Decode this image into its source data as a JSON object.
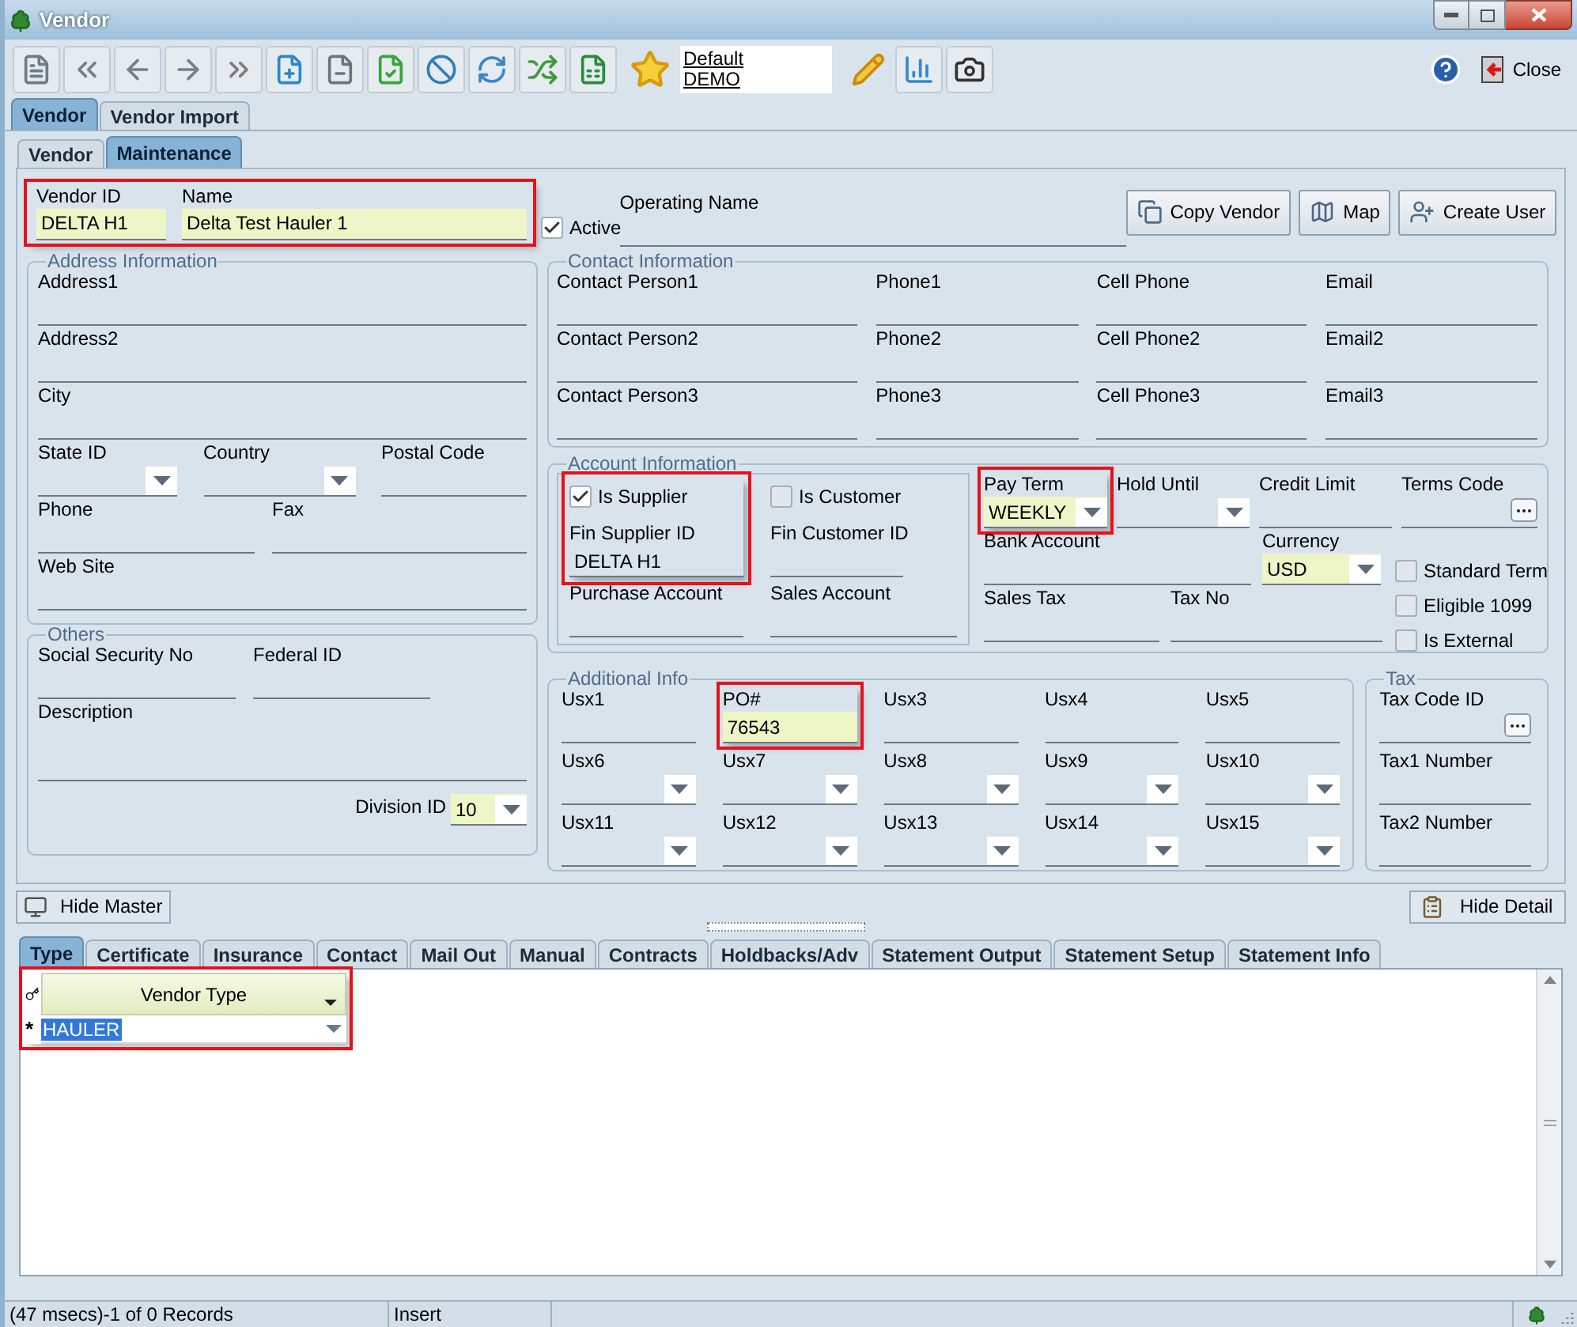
{
  "window": {
    "title": "Vendor"
  },
  "toolbar": {
    "profile_links": [
      "Default",
      "DEMO"
    ],
    "close_label": "Close"
  },
  "main_tabs": [
    {
      "label": "Vendor",
      "selected": true
    },
    {
      "label": "Vendor Import",
      "selected": false
    }
  ],
  "sub_tabs": [
    {
      "label": "Vendor",
      "selected": false
    },
    {
      "label": "Maintenance",
      "selected": true
    }
  ],
  "header": {
    "id_group": {
      "highlighted": true,
      "fields": [
        {
          "label": "Vendor ID",
          "value": "DELTA H1",
          "kind": "required-text"
        },
        {
          "label": "Name",
          "value": "Delta Test Hauler 1",
          "kind": "required-text"
        }
      ]
    },
    "active": {
      "label": "Active",
      "checked": true
    },
    "operating_name": {
      "label": "Operating Name",
      "kind": "text"
    },
    "buttons": [
      "Copy Vendor",
      "Map",
      "Create User"
    ]
  },
  "address_information": {
    "title": "Address Information",
    "rows": [
      [
        {
          "label": "Address1",
          "kind": "text"
        }
      ],
      [
        {
          "label": "Address2",
          "kind": "text"
        }
      ],
      [
        {
          "label": "City",
          "kind": "text"
        }
      ],
      [
        {
          "label": "State ID",
          "kind": "dropdown"
        },
        {
          "label": "Country",
          "kind": "dropdown"
        },
        {
          "label": "Postal Code",
          "kind": "text"
        }
      ],
      [
        {
          "label": "Phone",
          "kind": "text"
        },
        {
          "label": "Fax",
          "kind": "text"
        }
      ],
      [
        {
          "label": "Web Site",
          "kind": "text"
        }
      ]
    ]
  },
  "others": {
    "title": "Others",
    "rows": [
      [
        {
          "label": "Social Security No",
          "kind": "text"
        },
        {
          "label": "Federal ID",
          "kind": "text"
        }
      ],
      [
        {
          "label": "Description",
          "kind": "text"
        }
      ]
    ],
    "division": {
      "label": "Division ID",
      "value": "10",
      "kind": "required-dropdown"
    }
  },
  "contact_information": {
    "title": "Contact Information",
    "rows": [
      [
        {
          "label": "Contact Person1",
          "kind": "text"
        },
        {
          "label": "Phone1",
          "kind": "text"
        },
        {
          "label": "Cell Phone",
          "kind": "text"
        },
        {
          "label": "Email",
          "kind": "text"
        }
      ],
      [
        {
          "label": "Contact Person2",
          "kind": "text"
        },
        {
          "label": "Phone2",
          "kind": "text"
        },
        {
          "label": "Cell Phone2",
          "kind": "text"
        },
        {
          "label": "Email2",
          "kind": "text"
        }
      ],
      [
        {
          "label": "Contact Person3",
          "kind": "text"
        },
        {
          "label": "Phone3",
          "kind": "text"
        },
        {
          "label": "Cell Phone3",
          "kind": "text"
        },
        {
          "label": "Email3",
          "kind": "text"
        }
      ]
    ]
  },
  "account_information": {
    "title": "Account Information",
    "parties": [
      {
        "highlighted": true,
        "checkbox": {
          "label": "Is Supplier",
          "checked": true
        },
        "field": {
          "label": "Fin Supplier ID",
          "value": "DELTA H1",
          "kind": "text"
        },
        "account": {
          "label": "Purchase Account",
          "kind": "text"
        }
      },
      {
        "highlighted": false,
        "checkbox": {
          "label": "Is Customer",
          "checked": false
        },
        "field": {
          "label": "Fin Customer ID",
          "kind": "text"
        },
        "account": {
          "label": "Sales Account",
          "kind": "text"
        }
      }
    ],
    "terms": [
      [
        {
          "label": "Pay Term",
          "value": "WEEKLY",
          "kind": "required-dropdown",
          "highlighted": true
        },
        {
          "label": "Hold Until",
          "kind": "dropdown"
        },
        {
          "label": "Credit Limit",
          "kind": "text"
        },
        {
          "label": "Terms Code",
          "kind": "lookup"
        }
      ],
      [
        {
          "label": "Bank Account",
          "kind": "text"
        },
        {
          "label": "Currency",
          "value": "USD",
          "kind": "required-dropdown"
        }
      ],
      [
        {
          "label": "Sales Tax",
          "kind": "text"
        },
        {
          "label": "Tax No",
          "kind": "text"
        }
      ]
    ],
    "options": [
      {
        "label": "Standard Term",
        "checked": false
      },
      {
        "label": "Eligible 1099",
        "checked": false
      },
      {
        "label": "Is External",
        "checked": false
      }
    ]
  },
  "additional_info": {
    "title": "Additional Info",
    "fields": [
      {
        "label": "Usx1",
        "kind": "text"
      },
      {
        "label": "PO#",
        "value": "76543",
        "kind": "required-text",
        "highlighted": true
      },
      {
        "label": "Usx3",
        "kind": "text"
      },
      {
        "label": "Usx4",
        "kind": "text"
      },
      {
        "label": "Usx5",
        "kind": "text"
      },
      {
        "label": "Usx6",
        "kind": "dropdown"
      },
      {
        "label": "Usx7",
        "kind": "dropdown"
      },
      {
        "label": "Usx8",
        "kind": "dropdown"
      },
      {
        "label": "Usx9",
        "kind": "dropdown"
      },
      {
        "label": "Usx10",
        "kind": "dropdown"
      },
      {
        "label": "Usx11",
        "kind": "dropdown"
      },
      {
        "label": "Usx12",
        "kind": "dropdown"
      },
      {
        "label": "Usx13",
        "kind": "dropdown"
      },
      {
        "label": "Usx14",
        "kind": "dropdown"
      },
      {
        "label": "Usx15",
        "kind": "dropdown"
      }
    ]
  },
  "tax": {
    "title": "Tax",
    "fields": [
      {
        "label": "Tax Code ID",
        "kind": "lookup"
      },
      {
        "label": "Tax1 Number",
        "kind": "text"
      },
      {
        "label": "Tax2 Number",
        "kind": "text"
      }
    ]
  },
  "hide_master": "Hide Master",
  "hide_detail": "Hide Detail",
  "detail_tabs": [
    {
      "label": "Type",
      "selected": true
    },
    {
      "label": "Certificate",
      "selected": false
    },
    {
      "label": "Insurance",
      "selected": false
    },
    {
      "label": "Contact",
      "selected": false
    },
    {
      "label": "Mail Out",
      "selected": false
    },
    {
      "label": "Manual",
      "selected": false
    },
    {
      "label": "Contracts",
      "selected": false
    },
    {
      "label": "Holdbacks/Adv",
      "selected": false
    },
    {
      "label": "Statement Output",
      "selected": false
    },
    {
      "label": "Statement Setup",
      "selected": false
    },
    {
      "label": "Statement Info",
      "selected": false
    }
  ],
  "grid": {
    "highlighted": true,
    "column": "Vendor Type",
    "new_row_marker": "*",
    "rows": [
      {
        "value": "HAULER",
        "selected": true
      }
    ]
  },
  "status_bar": {
    "records": "(47 msecs)-1 of 0 Records",
    "mode": "Insert"
  }
}
